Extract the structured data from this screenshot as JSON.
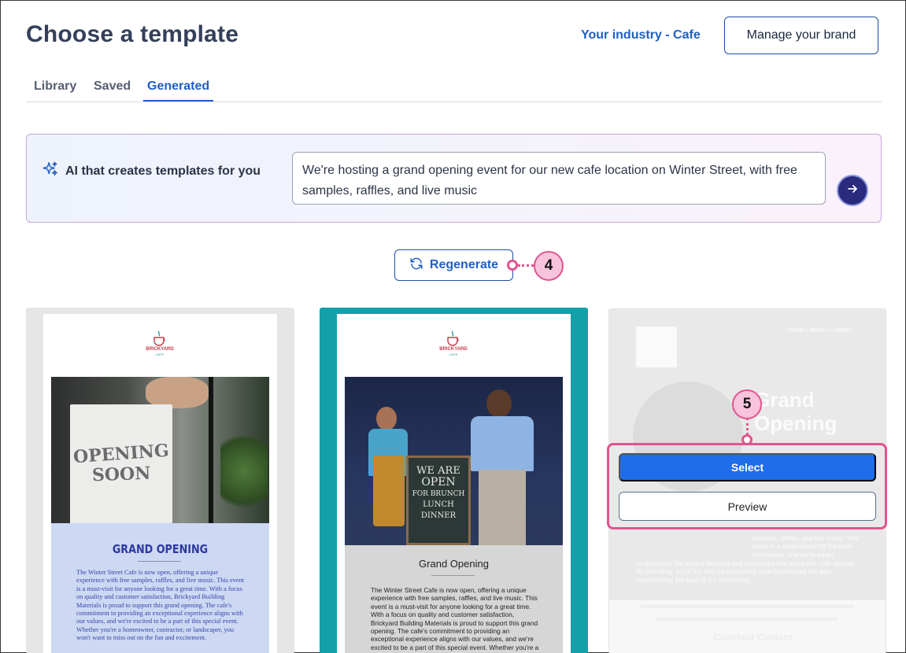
{
  "header": {
    "title": "Choose a template",
    "industry_link": "Your industry - Cafe",
    "manage_brand": "Manage your brand"
  },
  "tabs": [
    {
      "label": "Library",
      "active": false
    },
    {
      "label": "Saved",
      "active": false
    },
    {
      "label": "Generated",
      "active": true
    }
  ],
  "ai_panel": {
    "title": "AI that creates templates for you",
    "prompt_value": "We're hosting a grand opening event for our new cafe location on Winter Street, with free samples, raffles, and live music",
    "icon": "sparkle-icon",
    "submit_icon": "arrow-right-icon"
  },
  "regenerate": {
    "label": "Regenerate",
    "icon": "refresh-icon",
    "callout": "4"
  },
  "templates": [
    {
      "logo_name": "BRICKYARD",
      "logo_sub": "CAFE",
      "image_sign": [
        "OPENING",
        "SOON"
      ],
      "heading": "GRAND OPENING",
      "body": "The Winter Street Cafe is now open, offering a unique experience with free samples, raffles, and live music. This event is a must-visit for anyone looking for a great time. With a focus on quality and customer satisfaction, Brickyard Building Materials is proud to support this grand opening. The cafe's commitment to providing an exceptional experience aligns with our values, and we're excited to be a part of this special event. Whether you're a homeowner, contractor, or landscaper, you won't want to miss out on the fun and excitement."
    },
    {
      "logo_name": "BRICKYARD",
      "logo_sub": "CAFE",
      "image_sign": [
        "WE ARE",
        "OPEN",
        "FOR BRUNCH",
        "LUNCH",
        "DINNER"
      ],
      "heading": "Grand Opening",
      "body": "The Winter Street Cafe is now open, offering a unique experience with free samples, raffles, and live music. This event is a must-visit for anyone looking for a great time. With a focus on quality and customer satisfaction, Brickyard Building Materials is proud to support this grand opening. The cafe's commitment to providing an exceptional experience aligns with our values, and we're excited to be a part of this special event. Whether you're a homeowner, contractor, or landscaper, you won't want to"
    },
    {
      "nav": "Home / News / Contact",
      "heading_line1": "Grand",
      "heading_line2": "Opening",
      "faint_text": "to showcase the unique features and attractions that make this cafe special. By attending, you'll not only be supporting local businesses but also experiencing the best of our community.",
      "faint_side_text": "samples, raffles, and live music. This event is a must-attend for the local community, and we're eager",
      "footer_brand": "Constant Contact",
      "select_label": "Select",
      "preview_label": "Preview",
      "callout": "5"
    }
  ],
  "colors": {
    "accent": "#1f5fc4",
    "select_button": "#1f6de8",
    "callout": "#e0558f",
    "card2_border": "#13a0a8"
  }
}
